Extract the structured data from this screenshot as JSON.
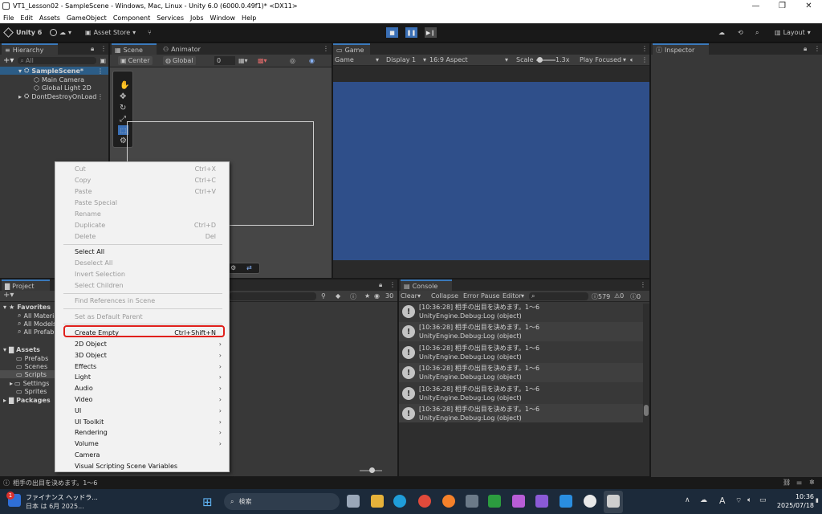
{
  "window": {
    "title": "VT1_Lesson02 - SampleScene - Windows, Mac, Linux - Unity 6.0 (6000.0.49f1)* <DX11>",
    "minimize": "—",
    "maximize": "❐",
    "close": "✕"
  },
  "menubar": [
    "File",
    "Edit",
    "Assets",
    "GameObject",
    "Component",
    "Services",
    "Jobs",
    "Window",
    "Help"
  ],
  "toolbar": {
    "unity_label": "Unity 6",
    "asset_store": "Asset Store",
    "layout": "Layout",
    "account_label": "▾"
  },
  "hierarchy": {
    "tab": "Hierarchy",
    "search_placeholder": "All",
    "scene": "SampleScene*",
    "items": [
      "Main Camera",
      "Global Light 2D"
    ],
    "dontdestroy": "DontDestroyOnLoad"
  },
  "scene": {
    "tab_scene": "Scene",
    "tab_animator": "Animator",
    "pivot": "Center",
    "space": "Global",
    "snap_value": "0"
  },
  "game": {
    "tab": "Game",
    "mode": "Game",
    "display": "Display 1",
    "aspect": "16:9 Aspect",
    "scale_label": "Scale",
    "scale_value": "1.3x",
    "play_mode": "Play Focused",
    "viewport_color": "#2f4f8a"
  },
  "inspector": {
    "tab": "Inspector"
  },
  "project": {
    "tab": "Project",
    "favorites": "Favorites",
    "fav_items": [
      "All Materia",
      "All Models",
      "All Prefab"
    ],
    "assets": "Assets",
    "asset_items": [
      "Prefabs",
      "Scenes",
      "Scripts",
      "Settings",
      "Sprites"
    ],
    "packages": "Packages",
    "count": "30"
  },
  "console": {
    "tab": "Console",
    "clear": "Clear",
    "collapse": "Collapse",
    "error_pause": "Error Pause",
    "editor": "Editor",
    "log_count": "579",
    "warn_count": "0",
    "err_count": "0",
    "entries": [
      {
        "line1": "[10:36:28] 相手の出目を決めます。1～6",
        "line2": "UnityEngine.Debug:Log (object)"
      },
      {
        "line1": "[10:36:28] 相手の出目を決めます。1～6",
        "line2": "UnityEngine.Debug:Log (object)"
      },
      {
        "line1": "[10:36:28] 相手の出目を決めます。1～6",
        "line2": "UnityEngine.Debug:Log (object)"
      },
      {
        "line1": "[10:36:28] 相手の出目を決めます。1～6",
        "line2": "UnityEngine.Debug:Log (object)"
      },
      {
        "line1": "[10:36:28] 相手の出目を決めます。1～6",
        "line2": "UnityEngine.Debug:Log (object)"
      },
      {
        "line1": "[10:36:28] 相手の出目を決めます。1～6",
        "line2": "UnityEngine.Debug:Log (object)"
      }
    ]
  },
  "context_menu": {
    "group1": [
      {
        "label": "Cut",
        "shortcut": "Ctrl+X"
      },
      {
        "label": "Copy",
        "shortcut": "Ctrl+C"
      },
      {
        "label": "Paste",
        "shortcut": "Ctrl+V"
      },
      {
        "label": "Paste Special",
        "shortcut": ""
      },
      {
        "label": "Rename",
        "shortcut": ""
      },
      {
        "label": "Duplicate",
        "shortcut": "Ctrl+D"
      },
      {
        "label": "Delete",
        "shortcut": "Del"
      }
    ],
    "select_all": "Select All",
    "group2_disabled": [
      "Deselect All",
      "Invert Selection",
      "Select Children"
    ],
    "find_refs": "Find References in Scene",
    "set_default_parent": "Set as Default Parent",
    "create_empty": "Create Empty",
    "create_empty_shortcut": "Ctrl+Shift+N",
    "submenus": [
      "2D Object",
      "3D Object",
      "Effects",
      "Light",
      "Audio",
      "Video",
      "UI",
      "UI Toolkit",
      "Rendering",
      "Volume"
    ],
    "camera": "Camera",
    "visual_scripting": "Visual Scripting Scene Variables",
    "highlight_color": "#e0201c"
  },
  "statusbar": {
    "message": "相手の出目を決めます。1～6"
  },
  "taskbar": {
    "news_line1": "ファイナンス ヘッドラ...",
    "news_line2": "日本 は 6月 2025...",
    "news_badge": "1",
    "search_placeholder": "検索",
    "ime": "A",
    "time": "10:36",
    "date": "2025/07/18"
  }
}
